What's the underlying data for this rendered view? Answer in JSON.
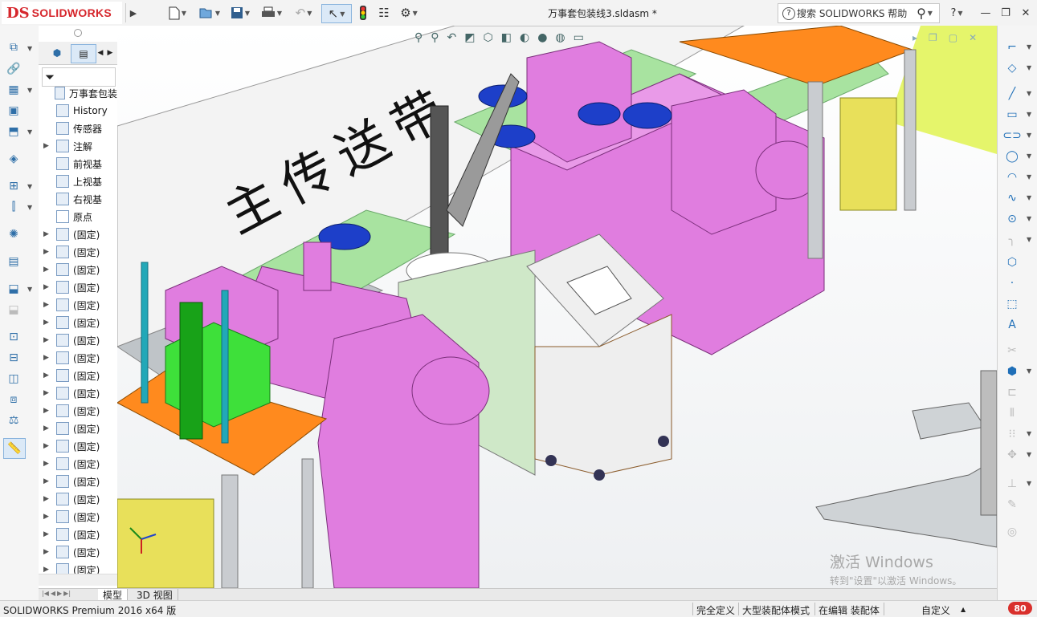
{
  "app": {
    "logo_ds": "DS",
    "logo_text": "SOLIDWORKS"
  },
  "document": {
    "title": "万事套包装线3.sldasm *"
  },
  "help_search": {
    "text": "搜索 SOLIDWORKS 帮助"
  },
  "toolbar": {
    "icons": [
      "new-document-icon",
      "open-icon",
      "save-icon",
      "print-icon",
      "undo-icon",
      "select-icon",
      "rebuild-icon",
      "file-properties-icon",
      "options-icon"
    ]
  },
  "feature_tree": {
    "root_label": "万事套包装",
    "items": [
      {
        "label": "History",
        "icon": "history-icon"
      },
      {
        "label": "传感器",
        "icon": "sensor-icon"
      },
      {
        "label": "注解",
        "icon": "annotation-icon"
      },
      {
        "label": "前视基",
        "icon": "plane-icon"
      },
      {
        "label": "上视基",
        "icon": "plane-icon"
      },
      {
        "label": "右视基",
        "icon": "plane-icon"
      },
      {
        "label": "原点",
        "icon": "origin-icon"
      }
    ],
    "component_label": "(固定)",
    "component_count": 20
  },
  "viewport": {
    "banner_text": "主传送带"
  },
  "bottom_tabs": [
    "模型",
    "3D 视图"
  ],
  "status": {
    "product": "SOLIDWORKS Premium 2016 x64 版",
    "fully_defined": "完全定义",
    "large_assembly": "大型装配体模式",
    "editing": "在编辑 装配体",
    "custom": "自定义"
  },
  "watermark": {
    "line1": "激活 Windows",
    "line2": "转到\"设置\"以激活 Windows。"
  },
  "badge": {
    "value": "80"
  },
  "colors": {
    "pink": "#e07ddf",
    "brand_red": "#d6262c",
    "green_plate": "#a8e3a0",
    "orange_top": "#ff8a1e",
    "blue_disc": "#1d3fc9"
  }
}
